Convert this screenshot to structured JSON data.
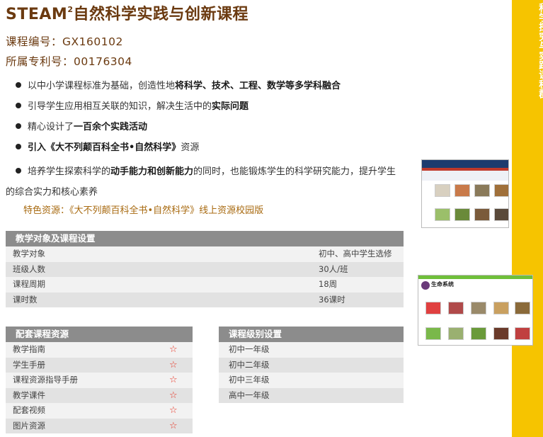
{
  "title": {
    "main": "STEAM",
    "sup": "2",
    "rest": "自然科学实践与创新课程"
  },
  "course_code": "课程编号：GX160102",
  "patent_no": "所属专利号：00176304",
  "bullets": {
    "b1_a": "以中小学课程标准为基础，创造性地",
    "b1_b": "将科学、技术、工程、数学等多学科融合",
    "b2_a": "引导学生应用相互关联的知识，解决生活中的",
    "b2_b": "实际问题",
    "b3_a": "精心设计了",
    "b3_b": "一百余个实践活动",
    "b4_a": "引入《大不列颠百科全书•自然科学》",
    "b4_b": "资源",
    "b5_a": "培养学生探索科学的",
    "b5_b": "动手能力和创新能力",
    "b5_c": "的同时，也能锻炼学生的科学研究能力，提升学生的综合实力和核心素养",
    "feature": "特色资源：《大不列颠百科全书•自然科学》线上资源校园版"
  },
  "side_label": "科学探究与实践课程群",
  "setup_table": {
    "header": "教学对象及课程设置",
    "rows": [
      {
        "label": "教学对象",
        "value": "初中、高中学生选修"
      },
      {
        "label": "班级人数",
        "value": "30人/班"
      },
      {
        "label": "课程周期",
        "value": "18周"
      },
      {
        "label": "课时数",
        "value": "36课时"
      }
    ]
  },
  "resources_table": {
    "header": "配套课程资源",
    "rows": [
      "教学指南",
      "学生手册",
      "课程资源指导手册",
      "教学课件",
      "配套视频",
      "图片资源"
    ],
    "star": "☆"
  },
  "levels_table": {
    "header": "课程级别设置",
    "rows": [
      "初中一年级",
      "初中二年级",
      "初中三年级",
      "高中一年级"
    ]
  },
  "screenshot2_title": "生命系统",
  "colors": {
    "brand": "#6b3a10",
    "side": "#f6c400",
    "header": "#8c8c8c",
    "star": "#e8301f"
  }
}
